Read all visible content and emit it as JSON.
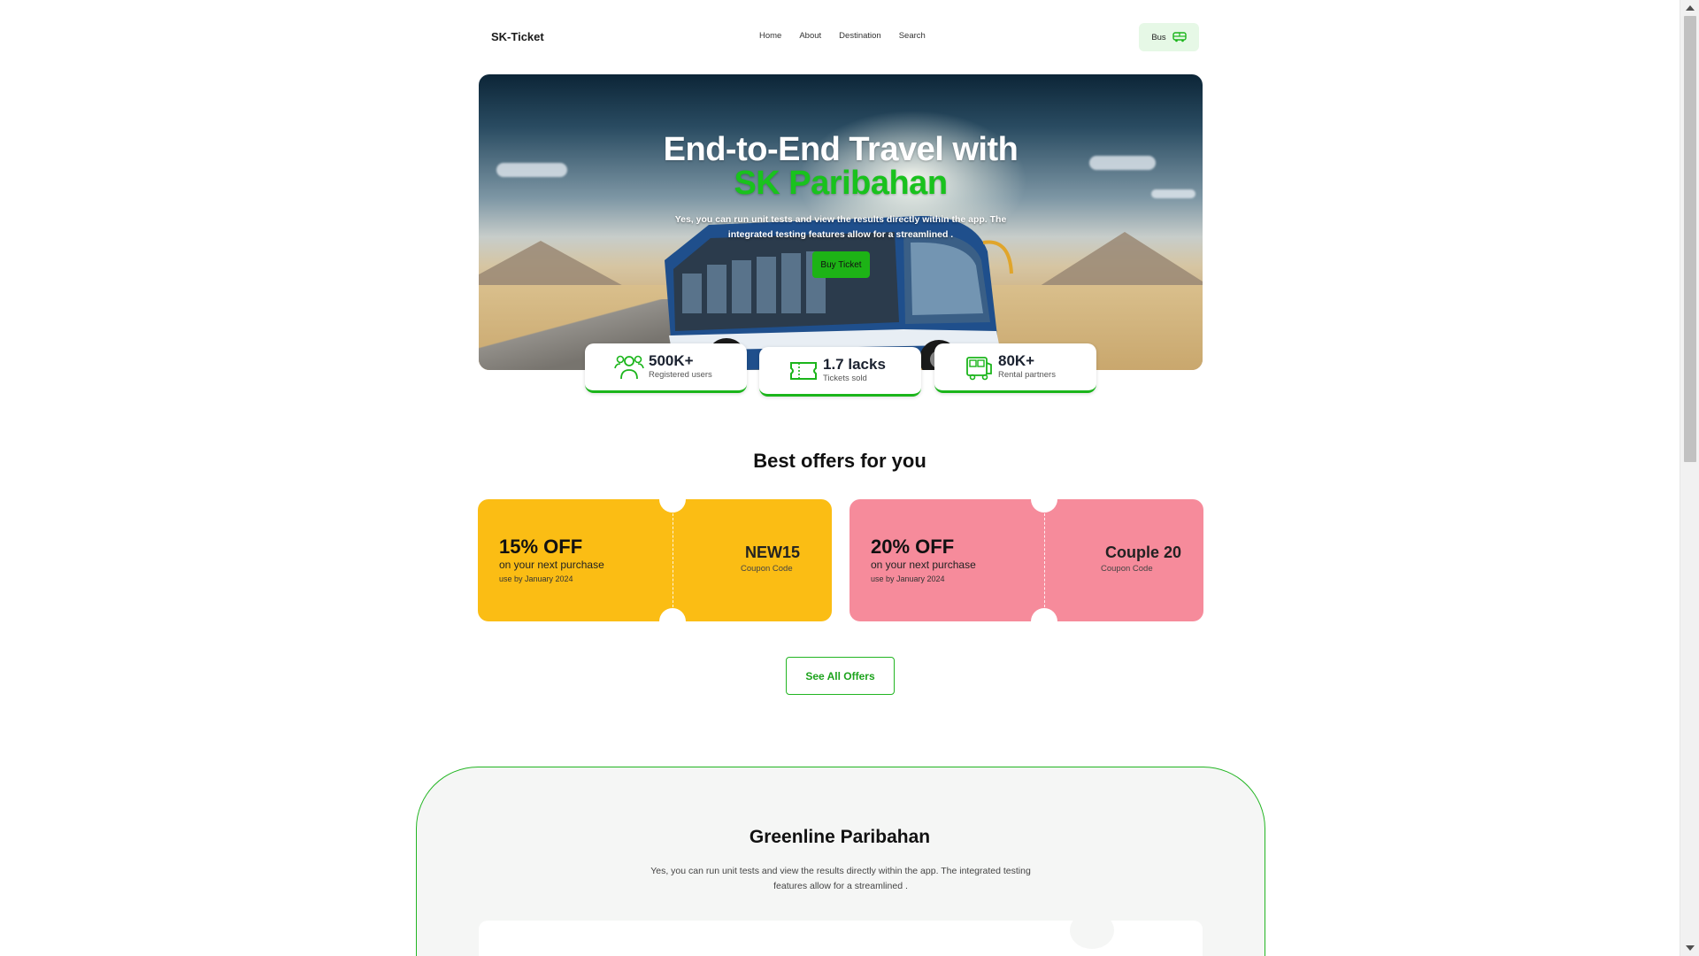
{
  "nav": {
    "brand": "SK-Ticket",
    "links": [
      "Home",
      "About",
      "Destination",
      "Search"
    ],
    "bus_button": "Bus"
  },
  "hero": {
    "title": "End-to-End Travel with",
    "title_accent": "SK Paribahan",
    "description": "Yes, you can run unit tests and view the results directly within the app. The integrated testing features allow for a streamlined .",
    "buy_button": "Buy Ticket"
  },
  "stats": [
    {
      "value": "500K+",
      "label": "Registered users",
      "icon": "users-icon"
    },
    {
      "value": "1.7 lacks",
      "label": "Tickets sold",
      "icon": "ticket-icon"
    },
    {
      "value": "80K+",
      "label": "Rental partners",
      "icon": "bus-icon"
    }
  ],
  "offers": {
    "title": "Best offers for you",
    "coupons": [
      {
        "discount": "15% OFF",
        "subtitle": "on your next purchase",
        "use_by": "use by January 2024",
        "code": "NEW15",
        "code_label": "Coupon Code",
        "color": "#fbbd14"
      },
      {
        "discount": "20% OFF",
        "subtitle": "on your next purchase",
        "use_by": "use by January 2024",
        "code": "Couple 20",
        "code_label": "Coupon Code",
        "color": "#f68b9b"
      }
    ],
    "see_all": "See All Offers"
  },
  "greenline": {
    "title": "Greenline Paribahan",
    "description": "Yes, you can run unit tests and view the results directly within the app. The integrated testing features allow for a streamlined ."
  },
  "colors": {
    "accent": "#1bb51b",
    "dark": "#1b2230"
  }
}
